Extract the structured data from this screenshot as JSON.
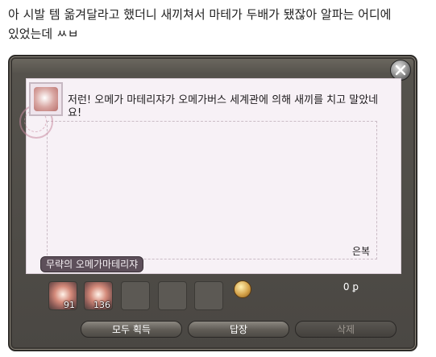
{
  "post": {
    "line1": "아 시발 템 옮겨달라고 했더니 새끼쳐서 마테가 두배가 됐잖아 알파는 어디에",
    "line2": "있었는데 ㅆㅂ"
  },
  "mail": {
    "message": "저런! 오메가 마테리쟈가 오메가버스 세계관에 의해 새끼를 치고 말았네요!",
    "signature": "은복",
    "sender": "무략의 오메가마테리쟈",
    "attachments": [
      {
        "count": "91",
        "icon": "materia-icon"
      },
      {
        "count": "136",
        "icon": "materia-icon"
      }
    ],
    "gil": "0",
    "gil_icon": "gil-coin-icon",
    "buttons": {
      "take_all": "모두 획득",
      "reply": "답장",
      "delete": "삭제"
    }
  },
  "colors": {
    "window_frame": "#55524c",
    "letter_bg": "#f7f1f6",
    "sender_tag": "#5d4f5a"
  }
}
